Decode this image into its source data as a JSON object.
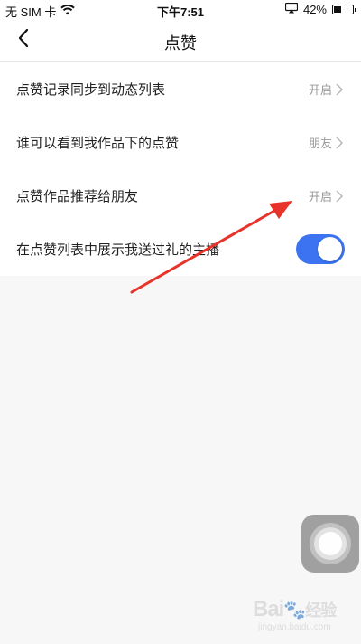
{
  "status_bar": {
    "carrier": "无 SIM 卡",
    "time": "下午7:51",
    "battery_percent": "42%",
    "battery_level": 0.42,
    "icons": [
      "wifi-icon",
      "airplay-icon",
      "battery-icon"
    ]
  },
  "nav": {
    "title": "点赞",
    "back_icon": "chevron-left-icon"
  },
  "settings": {
    "items": [
      {
        "label": "点赞记录同步到动态列表",
        "value": "开启",
        "control": "chevron"
      },
      {
        "label": "谁可以看到我作品下的点赞",
        "value": "朋友",
        "control": "chevron"
      },
      {
        "label": "点赞作品推荐给朋友",
        "value": "开启",
        "control": "chevron"
      },
      {
        "label": "在点赞列表中展示我送过礼的主播",
        "value": "",
        "control": "toggle",
        "toggle_on": true
      }
    ]
  },
  "colors": {
    "toggle_on": "#3b73f0",
    "annotation_arrow": "#e8332a",
    "background": "#f7f7f7",
    "value_text": "#9a9a9a"
  },
  "watermark": {
    "text": "Bai",
    "text2": "经验",
    "sub": "jingyan.baidu.com"
  }
}
